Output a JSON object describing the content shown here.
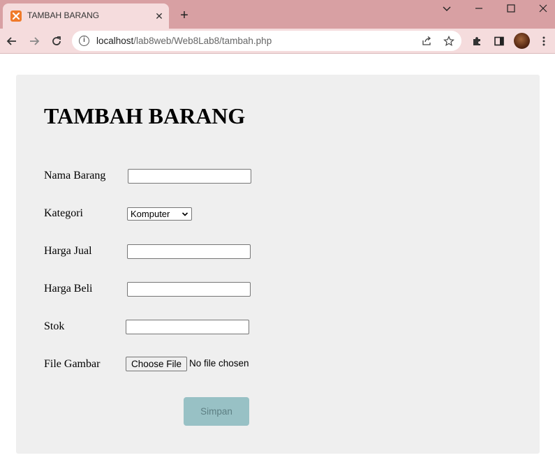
{
  "window": {
    "tab_title": "TAMBAH BARANG",
    "tab_close_label": "✕",
    "new_tab_label": "+",
    "controls": {
      "dropdown": "⌄",
      "minimize": "—",
      "maximize": "☐",
      "close": "✕"
    }
  },
  "toolbar": {
    "back": "←",
    "forward": "→",
    "reload": "↻",
    "url_host": "localhost",
    "url_path": "/lab8web/Web8Lab8/tambah.php",
    "info_glyph": "i"
  },
  "form": {
    "title": "TAMBAH BARANG",
    "fields": {
      "nama_barang": {
        "label": "Nama Barang",
        "value": ""
      },
      "kategori": {
        "label": "Kategori",
        "selected": "Komputer"
      },
      "harga_jual": {
        "label": "Harga Jual",
        "value": ""
      },
      "harga_beli": {
        "label": "Harga Beli",
        "value": ""
      },
      "stok": {
        "label": "Stok",
        "value": ""
      },
      "file_gambar": {
        "label": "File Gambar",
        "button": "Choose File",
        "status": "No file chosen"
      }
    },
    "submit_label": "Simpan"
  },
  "colors": {
    "titlebar": "#d8a0a3",
    "toolbar": "#f5dcdd",
    "card": "#efefef",
    "submit_bg": "#98c1c5",
    "favicon": "#f07a2a"
  }
}
